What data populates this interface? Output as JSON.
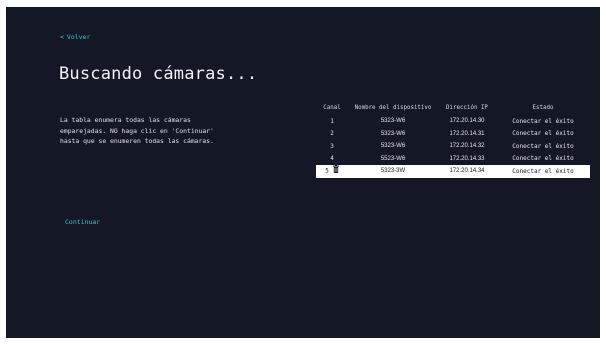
{
  "nav": {
    "back_label": "Volver",
    "back_icon": "chevron-left-icon"
  },
  "header": {
    "title": "Buscando cámaras..."
  },
  "instructions": "La tabla enumera todas las cámaras\nemparejadas. NO haga clic en 'Continuar'\nhasta que se enumeren todas las cámaras.",
  "actions": {
    "continue_label": "Continuar"
  },
  "table": {
    "columns": [
      "Canal",
      "Nombre del dispositivo",
      "Dirección IP",
      "Estado"
    ],
    "rows": [
      {
        "canal": "1",
        "name": "5323-W6",
        "ip": "172.20.14.30",
        "status": "Conectar el éxito"
      },
      {
        "canal": "2",
        "name": "5323-W6",
        "ip": "172.20.14.31",
        "status": "Conectar el éxito"
      },
      {
        "canal": "3",
        "name": "5323-W6",
        "ip": "172.20.14.32",
        "status": "Conectar el éxito"
      },
      {
        "canal": "4",
        "name": "5523-W6",
        "ip": "172.20.14.33",
        "status": "Conectar el éxito"
      },
      {
        "canal": "5",
        "name": "5323-3W",
        "ip": "172.20.14.34",
        "status": "Conectar el éxito",
        "selected": true,
        "icon": "trash-icon"
      }
    ]
  },
  "colors": {
    "background": "#141726",
    "accent": "#34c6d6",
    "text": "#e8eaf0",
    "selected_row": "#ffffff"
  }
}
